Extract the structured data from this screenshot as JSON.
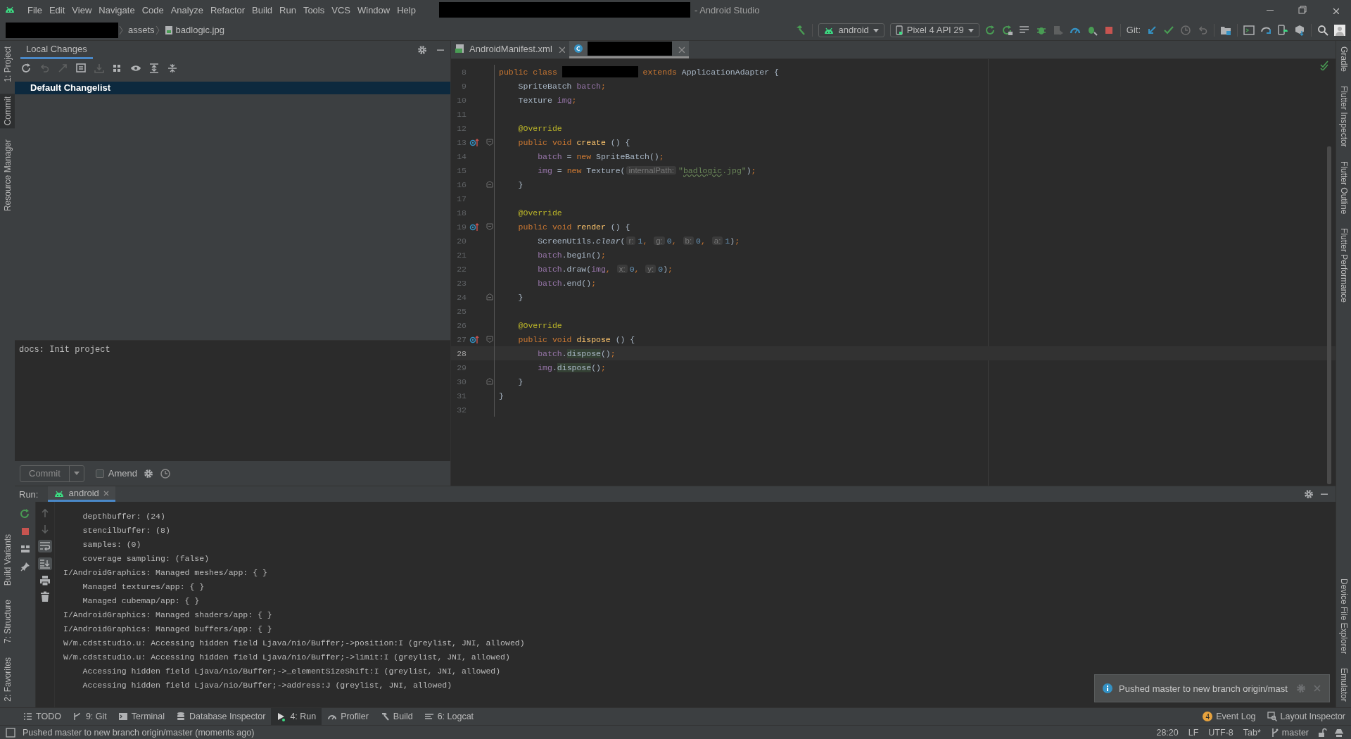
{
  "title_bar": {
    "menu": [
      "File",
      "Edit",
      "View",
      "Navigate",
      "Code",
      "Analyze",
      "Refactor",
      "Build",
      "Run",
      "Tools",
      "VCS",
      "Window",
      "Help"
    ],
    "title": "- Android Studio"
  },
  "nav_bar": {
    "breadcrumbs": [
      "assets",
      "badlogic.jpg"
    ],
    "run_config": "android",
    "device": "Pixel 4 API 29",
    "git_label": "Git:"
  },
  "left_stripe": {
    "top": [
      {
        "label": "1: Project",
        "selected": false
      },
      {
        "label": "Commit",
        "selected": true
      },
      {
        "label": "Resource Manager",
        "selected": false
      }
    ],
    "bottom": [
      {
        "label": "Build Variants",
        "selected": false
      },
      {
        "label": "7: Structure",
        "selected": false
      },
      {
        "label": "2: Favorites",
        "selected": false
      }
    ]
  },
  "right_stripe": {
    "top": [
      "Gradle",
      "Flutter Inspector",
      "Flutter Outline",
      "Flutter Performance"
    ],
    "bottom": [
      "Device File Explorer",
      "Emulator"
    ]
  },
  "commit_panel": {
    "tab": "Local Changes",
    "changelists": [
      {
        "label": "Default Changelist",
        "selected": true
      }
    ],
    "message": "docs: Init project",
    "commit_button": "Commit",
    "amend": {
      "label": "Amend",
      "checked": false
    }
  },
  "editor": {
    "tabs": [
      {
        "kind": "file",
        "label": "AndroidManifest.xml",
        "selected": false
      },
      {
        "kind": "redacted",
        "selected": true
      }
    ],
    "lines": [
      {
        "number": "8",
        "current": false,
        "override": false,
        "tokens": [
          {
            "kind": "kw",
            "text": "public class "
          },
          {
            "kind": "redacted"
          },
          {
            "kind": "kw",
            "text": " extends "
          },
          {
            "kind": "plain",
            "text": "ApplicationAdapter {"
          }
        ]
      },
      {
        "number": "9",
        "current": false,
        "override": false,
        "tokens": [
          {
            "kind": "plain",
            "text": "    SpriteBatch "
          },
          {
            "kind": "field",
            "text": "batch"
          },
          {
            "kind": "kw",
            "text": ";"
          }
        ]
      },
      {
        "number": "10",
        "current": false,
        "override": false,
        "tokens": [
          {
            "kind": "plain",
            "text": "    Texture "
          },
          {
            "kind": "field",
            "text": "img"
          },
          {
            "kind": "kw",
            "text": ";"
          }
        ]
      },
      {
        "number": "11",
        "current": false,
        "override": false
      },
      {
        "number": "12",
        "current": false,
        "override": false,
        "tokens": [
          {
            "kind": "ann",
            "text": "    @Override"
          }
        ]
      },
      {
        "number": "13",
        "current": false,
        "override": true,
        "fold_start": true,
        "tokens": [
          {
            "kind": "kw",
            "text": "    public void "
          },
          {
            "kind": "method",
            "text": "create"
          },
          {
            "kind": "plain",
            "text": " () {"
          }
        ]
      },
      {
        "number": "14",
        "current": false,
        "override": false,
        "tokens": [
          {
            "kind": "field",
            "text": "        batch"
          },
          {
            "kind": "plain",
            "text": " = "
          },
          {
            "kind": "kw",
            "text": "new "
          },
          {
            "kind": "plain",
            "text": "SpriteBatch()"
          },
          {
            "kind": "kw",
            "text": ";"
          }
        ]
      },
      {
        "number": "15",
        "current": false,
        "override": false,
        "tokens": [
          {
            "kind": "field",
            "text": "        img"
          },
          {
            "kind": "plain",
            "text": " = "
          },
          {
            "kind": "kw",
            "text": "new "
          },
          {
            "kind": "plain",
            "text": "Texture("
          },
          {
            "kind": "hint",
            "text": "internalPath:"
          },
          {
            "kind": "string",
            "text": "\""
          },
          {
            "kind": "typo",
            "text": "badlogic"
          },
          {
            "kind": "string",
            "text": ".jpg\""
          },
          {
            "kind": "plain",
            "text": ")"
          },
          {
            "kind": "kw",
            "text": ";"
          }
        ]
      },
      {
        "number": "16",
        "current": false,
        "override": false,
        "fold_end": true,
        "tokens": [
          {
            "kind": "plain",
            "text": "    }"
          }
        ]
      },
      {
        "number": "17",
        "current": false,
        "override": false
      },
      {
        "number": "18",
        "current": false,
        "override": false,
        "tokens": [
          {
            "kind": "ann",
            "text": "    @Override"
          }
        ]
      },
      {
        "number": "19",
        "current": false,
        "override": true,
        "fold_start": true,
        "tokens": [
          {
            "kind": "kw",
            "text": "    public void "
          },
          {
            "kind": "method",
            "text": "render"
          },
          {
            "kind": "plain",
            "text": " () {"
          }
        ]
      },
      {
        "number": "20",
        "current": false,
        "override": false,
        "tokens": [
          {
            "kind": "plain",
            "text": "        ScreenUtils."
          },
          {
            "kind": "italic",
            "text": "clear"
          },
          {
            "kind": "plain",
            "text": "("
          },
          {
            "kind": "hint",
            "text": "r:"
          },
          {
            "kind": "num",
            "text": "1"
          },
          {
            "kind": "kw",
            "text": ", "
          },
          {
            "kind": "hint",
            "text": "g:"
          },
          {
            "kind": "num",
            "text": "0"
          },
          {
            "kind": "kw",
            "text": ", "
          },
          {
            "kind": "hint",
            "text": "b:"
          },
          {
            "kind": "num",
            "text": "0"
          },
          {
            "kind": "kw",
            "text": ", "
          },
          {
            "kind": "hint",
            "text": "a:"
          },
          {
            "kind": "num",
            "text": "1"
          },
          {
            "kind": "plain",
            "text": ")"
          },
          {
            "kind": "kw",
            "text": ";"
          }
        ]
      },
      {
        "number": "21",
        "current": false,
        "override": false,
        "tokens": [
          {
            "kind": "field",
            "text": "        batch"
          },
          {
            "kind": "plain",
            "text": ".begin()"
          },
          {
            "kind": "kw",
            "text": ";"
          }
        ]
      },
      {
        "number": "22",
        "current": false,
        "override": false,
        "tokens": [
          {
            "kind": "field",
            "text": "        batch"
          },
          {
            "kind": "plain",
            "text": ".draw("
          },
          {
            "kind": "field",
            "text": "img"
          },
          {
            "kind": "kw",
            "text": ", "
          },
          {
            "kind": "hint",
            "text": "x:"
          },
          {
            "kind": "num",
            "text": "0"
          },
          {
            "kind": "kw",
            "text": ", "
          },
          {
            "kind": "hint",
            "text": "y:"
          },
          {
            "kind": "num",
            "text": "0"
          },
          {
            "kind": "plain",
            "text": ")"
          },
          {
            "kind": "kw",
            "text": ";"
          }
        ]
      },
      {
        "number": "23",
        "current": false,
        "override": false,
        "tokens": [
          {
            "kind": "field",
            "text": "        batch"
          },
          {
            "kind": "plain",
            "text": ".end()"
          },
          {
            "kind": "kw",
            "text": ";"
          }
        ]
      },
      {
        "number": "24",
        "current": false,
        "override": false,
        "fold_end": true,
        "tokens": [
          {
            "kind": "plain",
            "text": "    }"
          }
        ]
      },
      {
        "number": "25",
        "current": false,
        "override": false
      },
      {
        "number": "26",
        "current": false,
        "override": false,
        "tokens": [
          {
            "kind": "ann",
            "text": "    @Override"
          }
        ]
      },
      {
        "number": "27",
        "current": false,
        "override": true,
        "fold_start": true,
        "tokens": [
          {
            "kind": "kw",
            "text": "    public void "
          },
          {
            "kind": "method",
            "text": "dispose"
          },
          {
            "kind": "plain",
            "text": " () {"
          }
        ]
      },
      {
        "number": "28",
        "current": true,
        "override": false,
        "tokens": [
          {
            "kind": "field",
            "text": "        batch"
          },
          {
            "kind": "plain",
            "text": "."
          },
          {
            "kind": "usage",
            "text": "dispose"
          },
          {
            "kind": "plain",
            "text": "()"
          },
          {
            "kind": "kw",
            "text": ";"
          }
        ]
      },
      {
        "number": "29",
        "current": false,
        "override": false,
        "tokens": [
          {
            "kind": "field",
            "text": "        img"
          },
          {
            "kind": "plain",
            "text": "."
          },
          {
            "kind": "usage",
            "text": "dispose"
          },
          {
            "kind": "plain",
            "text": "()"
          },
          {
            "kind": "kw",
            "text": ";"
          }
        ]
      },
      {
        "number": "30",
        "current": false,
        "override": false,
        "fold_end": true,
        "tokens": [
          {
            "kind": "plain",
            "text": "    }"
          }
        ]
      },
      {
        "number": "31",
        "current": false,
        "override": false,
        "tokens": [
          {
            "kind": "plain",
            "text": "}"
          }
        ]
      },
      {
        "number": "32",
        "current": false,
        "override": false
      }
    ]
  },
  "run_panel": {
    "label": "Run:",
    "tabs": [
      {
        "label": "android",
        "selected": true
      }
    ],
    "console": [
      "    depthbuffer: (24)",
      "    stencilbuffer: (8)",
      "    samples: (0)",
      "    coverage sampling: (false)",
      "I/AndroidGraphics: Managed meshes/app: { }",
      "    Managed textures/app: { }",
      "    Managed cubemap/app: { }",
      "I/AndroidGraphics: Managed shaders/app: { }",
      "I/AndroidGraphics: Managed buffers/app: { }",
      "W/m.cdststudio.u: Accessing hidden field Ljava/nio/Buffer;->position:I (greylist, JNI, allowed)",
      "W/m.cdststudio.u: Accessing hidden field Ljava/nio/Buffer;->limit:I (greylist, JNI, allowed)",
      "    Accessing hidden field Ljava/nio/Buffer;->_elementSizeShift:I (greylist, JNI, allowed)",
      "    Accessing hidden field Ljava/nio/Buffer;->address:J (greylist, JNI, allowed)"
    ]
  },
  "notification": {
    "text": "Pushed master to new branch origin/mast"
  },
  "tool_bar": {
    "left": [
      {
        "kind": "todo",
        "label": "TODO",
        "selected": false
      },
      {
        "kind": "git",
        "label": "9: Git",
        "selected": false
      },
      {
        "kind": "terminal",
        "label": "Terminal",
        "selected": false
      },
      {
        "kind": "database",
        "label": "Database Inspector",
        "selected": false
      },
      {
        "kind": "run",
        "label": "4: Run",
        "selected": true
      },
      {
        "kind": "profiler",
        "label": "Profiler",
        "selected": false
      },
      {
        "kind": "build",
        "label": "Build",
        "selected": false
      },
      {
        "kind": "logcat",
        "label": "6: Logcat",
        "selected": false
      }
    ],
    "event_log": {
      "label": "Event Log",
      "badge": "4"
    },
    "layout_inspector": "Layout Inspector"
  },
  "status_bar": {
    "message": "Pushed master to new branch origin/master (moments ago)",
    "items": [
      "28:20",
      "LF",
      "UTF-8",
      "Tab*"
    ],
    "branch": "master"
  }
}
